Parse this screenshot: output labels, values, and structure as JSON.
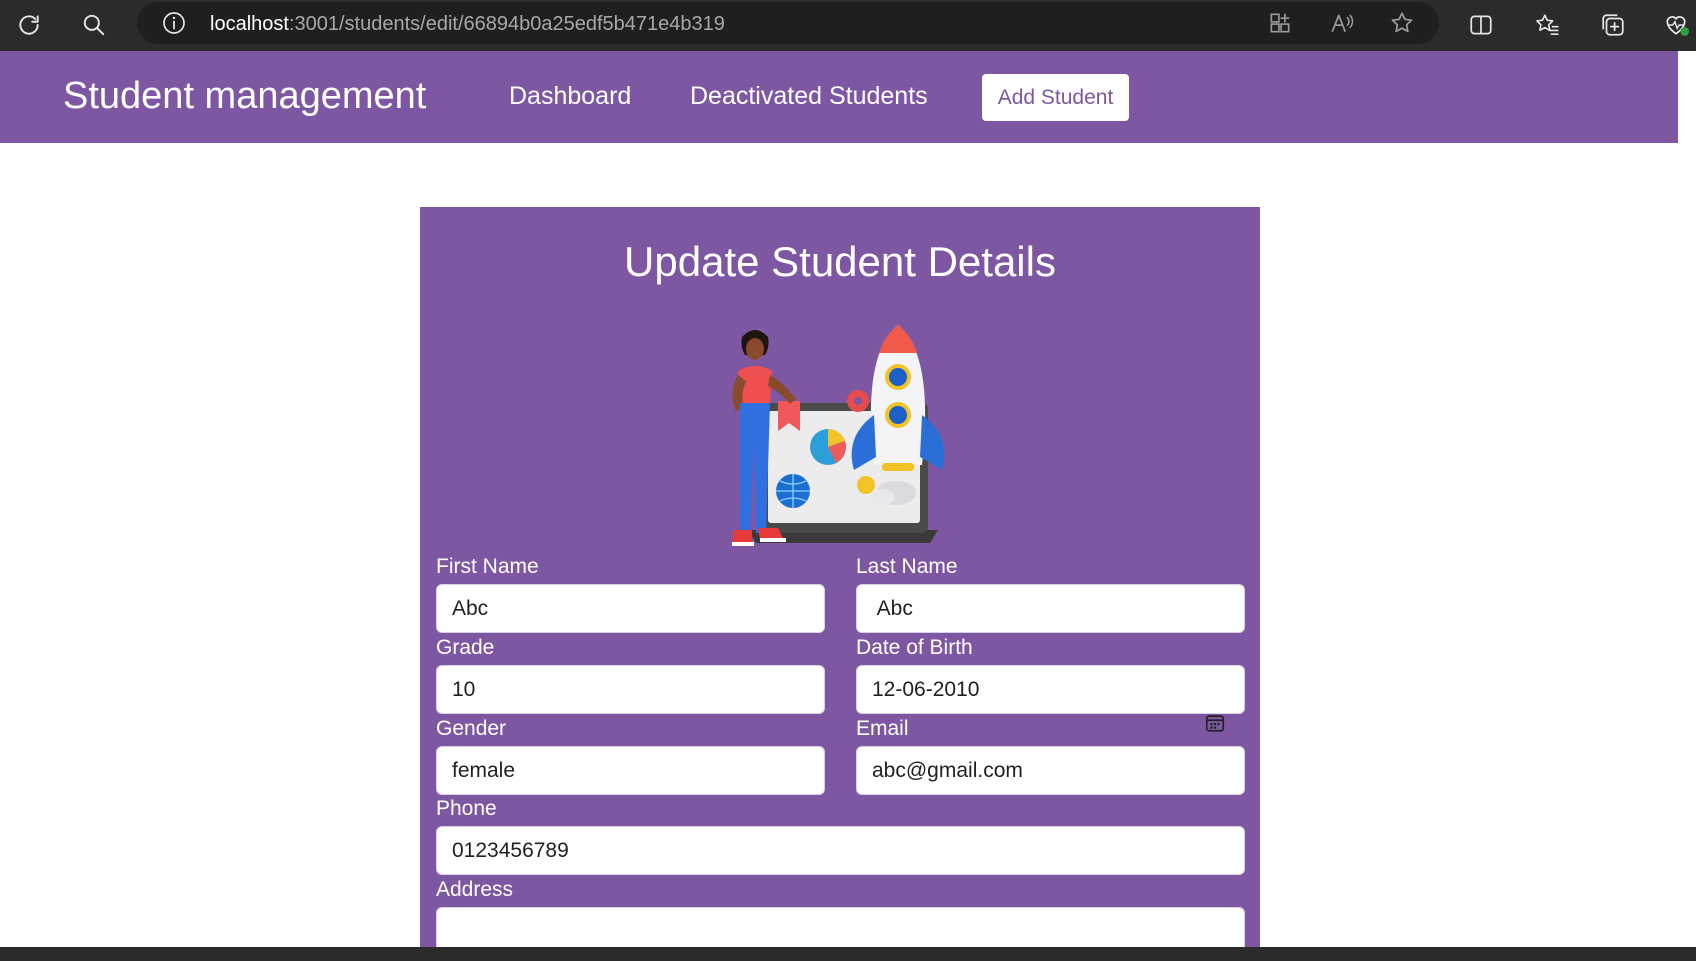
{
  "browser": {
    "url_host": "localhost",
    "url_rest": ":3001/students/edit/66894b0a25edf5b471e4b319",
    "icons": [
      "refresh-icon",
      "search-icon",
      "info-icon",
      "apps-icon",
      "read-aloud-icon",
      "favorite-star-icon",
      "split-screen-icon",
      "favorites-list-icon",
      "collections-icon",
      "health-icon"
    ]
  },
  "header": {
    "brand": "Student management",
    "nav": {
      "dashboard": "Dashboard",
      "deactivated": "Deactivated Students"
    },
    "add_button": "Add Student"
  },
  "form": {
    "title": "Update Student Details",
    "first_name": {
      "label": "First Name",
      "value": "Abc"
    },
    "last_name": {
      "label": "Last Name",
      "value": " Abc"
    },
    "grade": {
      "label": "Grade",
      "value": "10"
    },
    "dob": {
      "label": "Date of Birth",
      "value": "12-06-2010"
    },
    "gender": {
      "label": "Gender",
      "value": "female"
    },
    "email": {
      "label": "Email",
      "value": "abc@gmail.com"
    },
    "phone": {
      "label": "Phone",
      "value": "0123456789"
    },
    "address": {
      "label": "Address",
      "value": ""
    }
  },
  "colors": {
    "accent": "#7e57a2",
    "chrome": "#2b2b2b",
    "address_bar": "#1f1f1f"
  }
}
